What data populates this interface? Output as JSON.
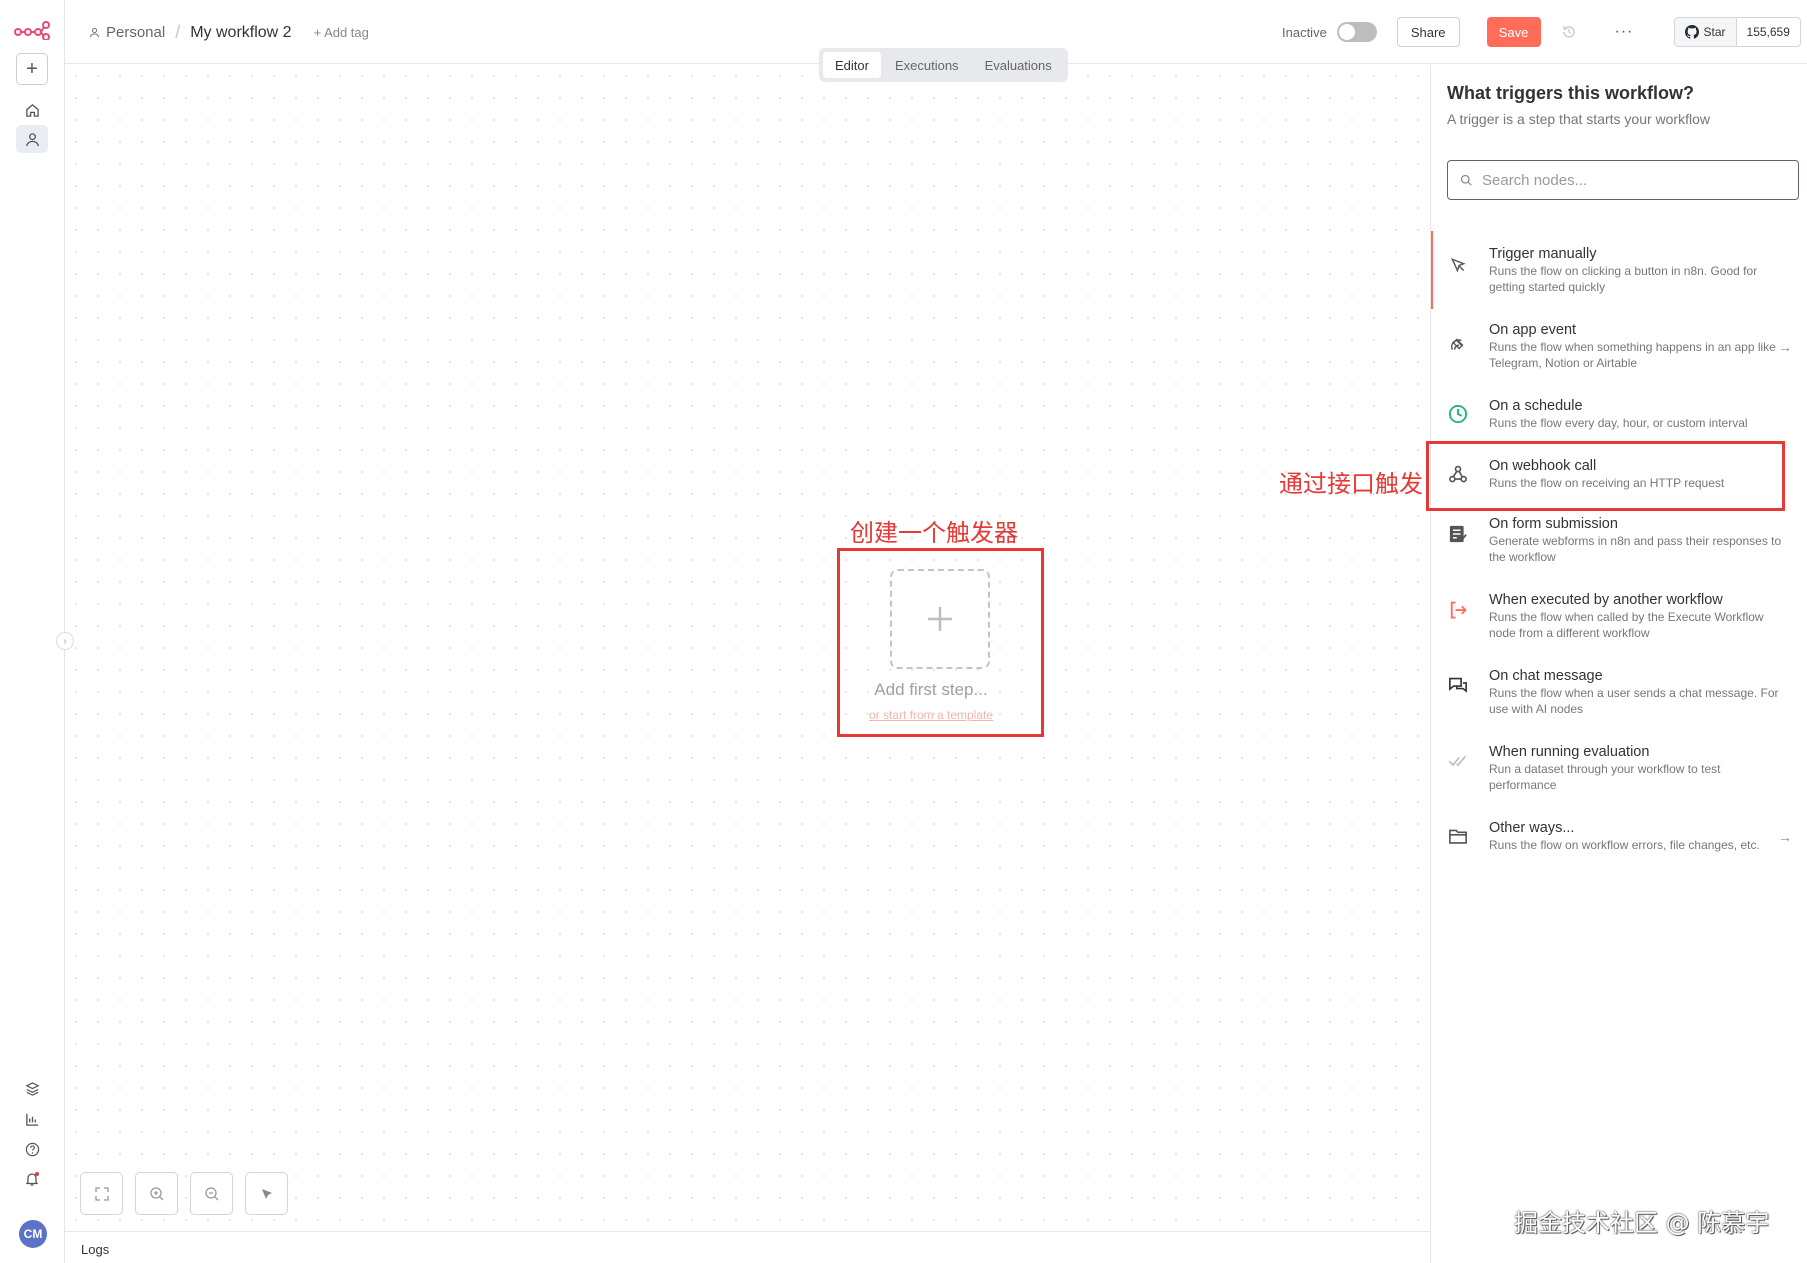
{
  "header": {
    "project": "Personal",
    "workflow_name": "My workflow 2",
    "add_tag": "+ Add tag",
    "status_label": "Inactive",
    "share_label": "Share",
    "save_label": "Save",
    "more_label": "···",
    "star_label": "Star",
    "star_count": "155,659"
  },
  "tabs": [
    {
      "label": "Editor",
      "active": true
    },
    {
      "label": "Executions",
      "active": false
    },
    {
      "label": "Evaluations",
      "active": false
    }
  ],
  "canvas": {
    "add_first_step": "Add first step...",
    "template_link": "or start from a template",
    "annotation_create": "创建一个触发器",
    "annotation_webhook": "通过接口触发"
  },
  "logs_label": "Logs",
  "avatar_initials": "CM",
  "panel": {
    "title": "What triggers this workflow?",
    "subtitle": "A trigger is a step that starts your workflow",
    "search_placeholder": "Search nodes...",
    "items": [
      {
        "title": "Trigger manually",
        "desc": "Runs the flow on clicking a button in n8n. Good for getting started quickly",
        "icon": "cursor-icon"
      },
      {
        "title": "On app event",
        "desc": "Runs the flow when something happens in an app like Telegram, Notion or Airtable",
        "icon": "satellite-icon"
      },
      {
        "title": "On a schedule",
        "desc": "Runs the flow every day, hour, or custom interval",
        "icon": "clock-icon"
      },
      {
        "title": "On webhook call",
        "desc": "Runs the flow on receiving an HTTP request",
        "icon": "webhook-icon"
      },
      {
        "title": "On form submission",
        "desc": "Generate webforms in n8n and pass their responses to the workflow",
        "icon": "form-icon"
      },
      {
        "title": "When executed by another workflow",
        "desc": "Runs the flow when called by the Execute Workflow node from a different workflow",
        "icon": "sign-in-icon"
      },
      {
        "title": "On chat message",
        "desc": "Runs the flow when a user sends a chat message. For use with AI nodes",
        "icon": "chat-icon"
      },
      {
        "title": "When running evaluation",
        "desc": "Run a dataset through your workflow to test performance",
        "icon": "check-double-icon"
      },
      {
        "title": "Other ways...",
        "desc": "Runs the flow on workflow errors, file changes, etc.",
        "icon": "folder-icon"
      }
    ]
  },
  "watermark": "掘金技术社区 @ 陈慕宇",
  "colors": {
    "accent": "#ff6d5a",
    "annotation": "#e53935",
    "schedule": "#22b573"
  }
}
